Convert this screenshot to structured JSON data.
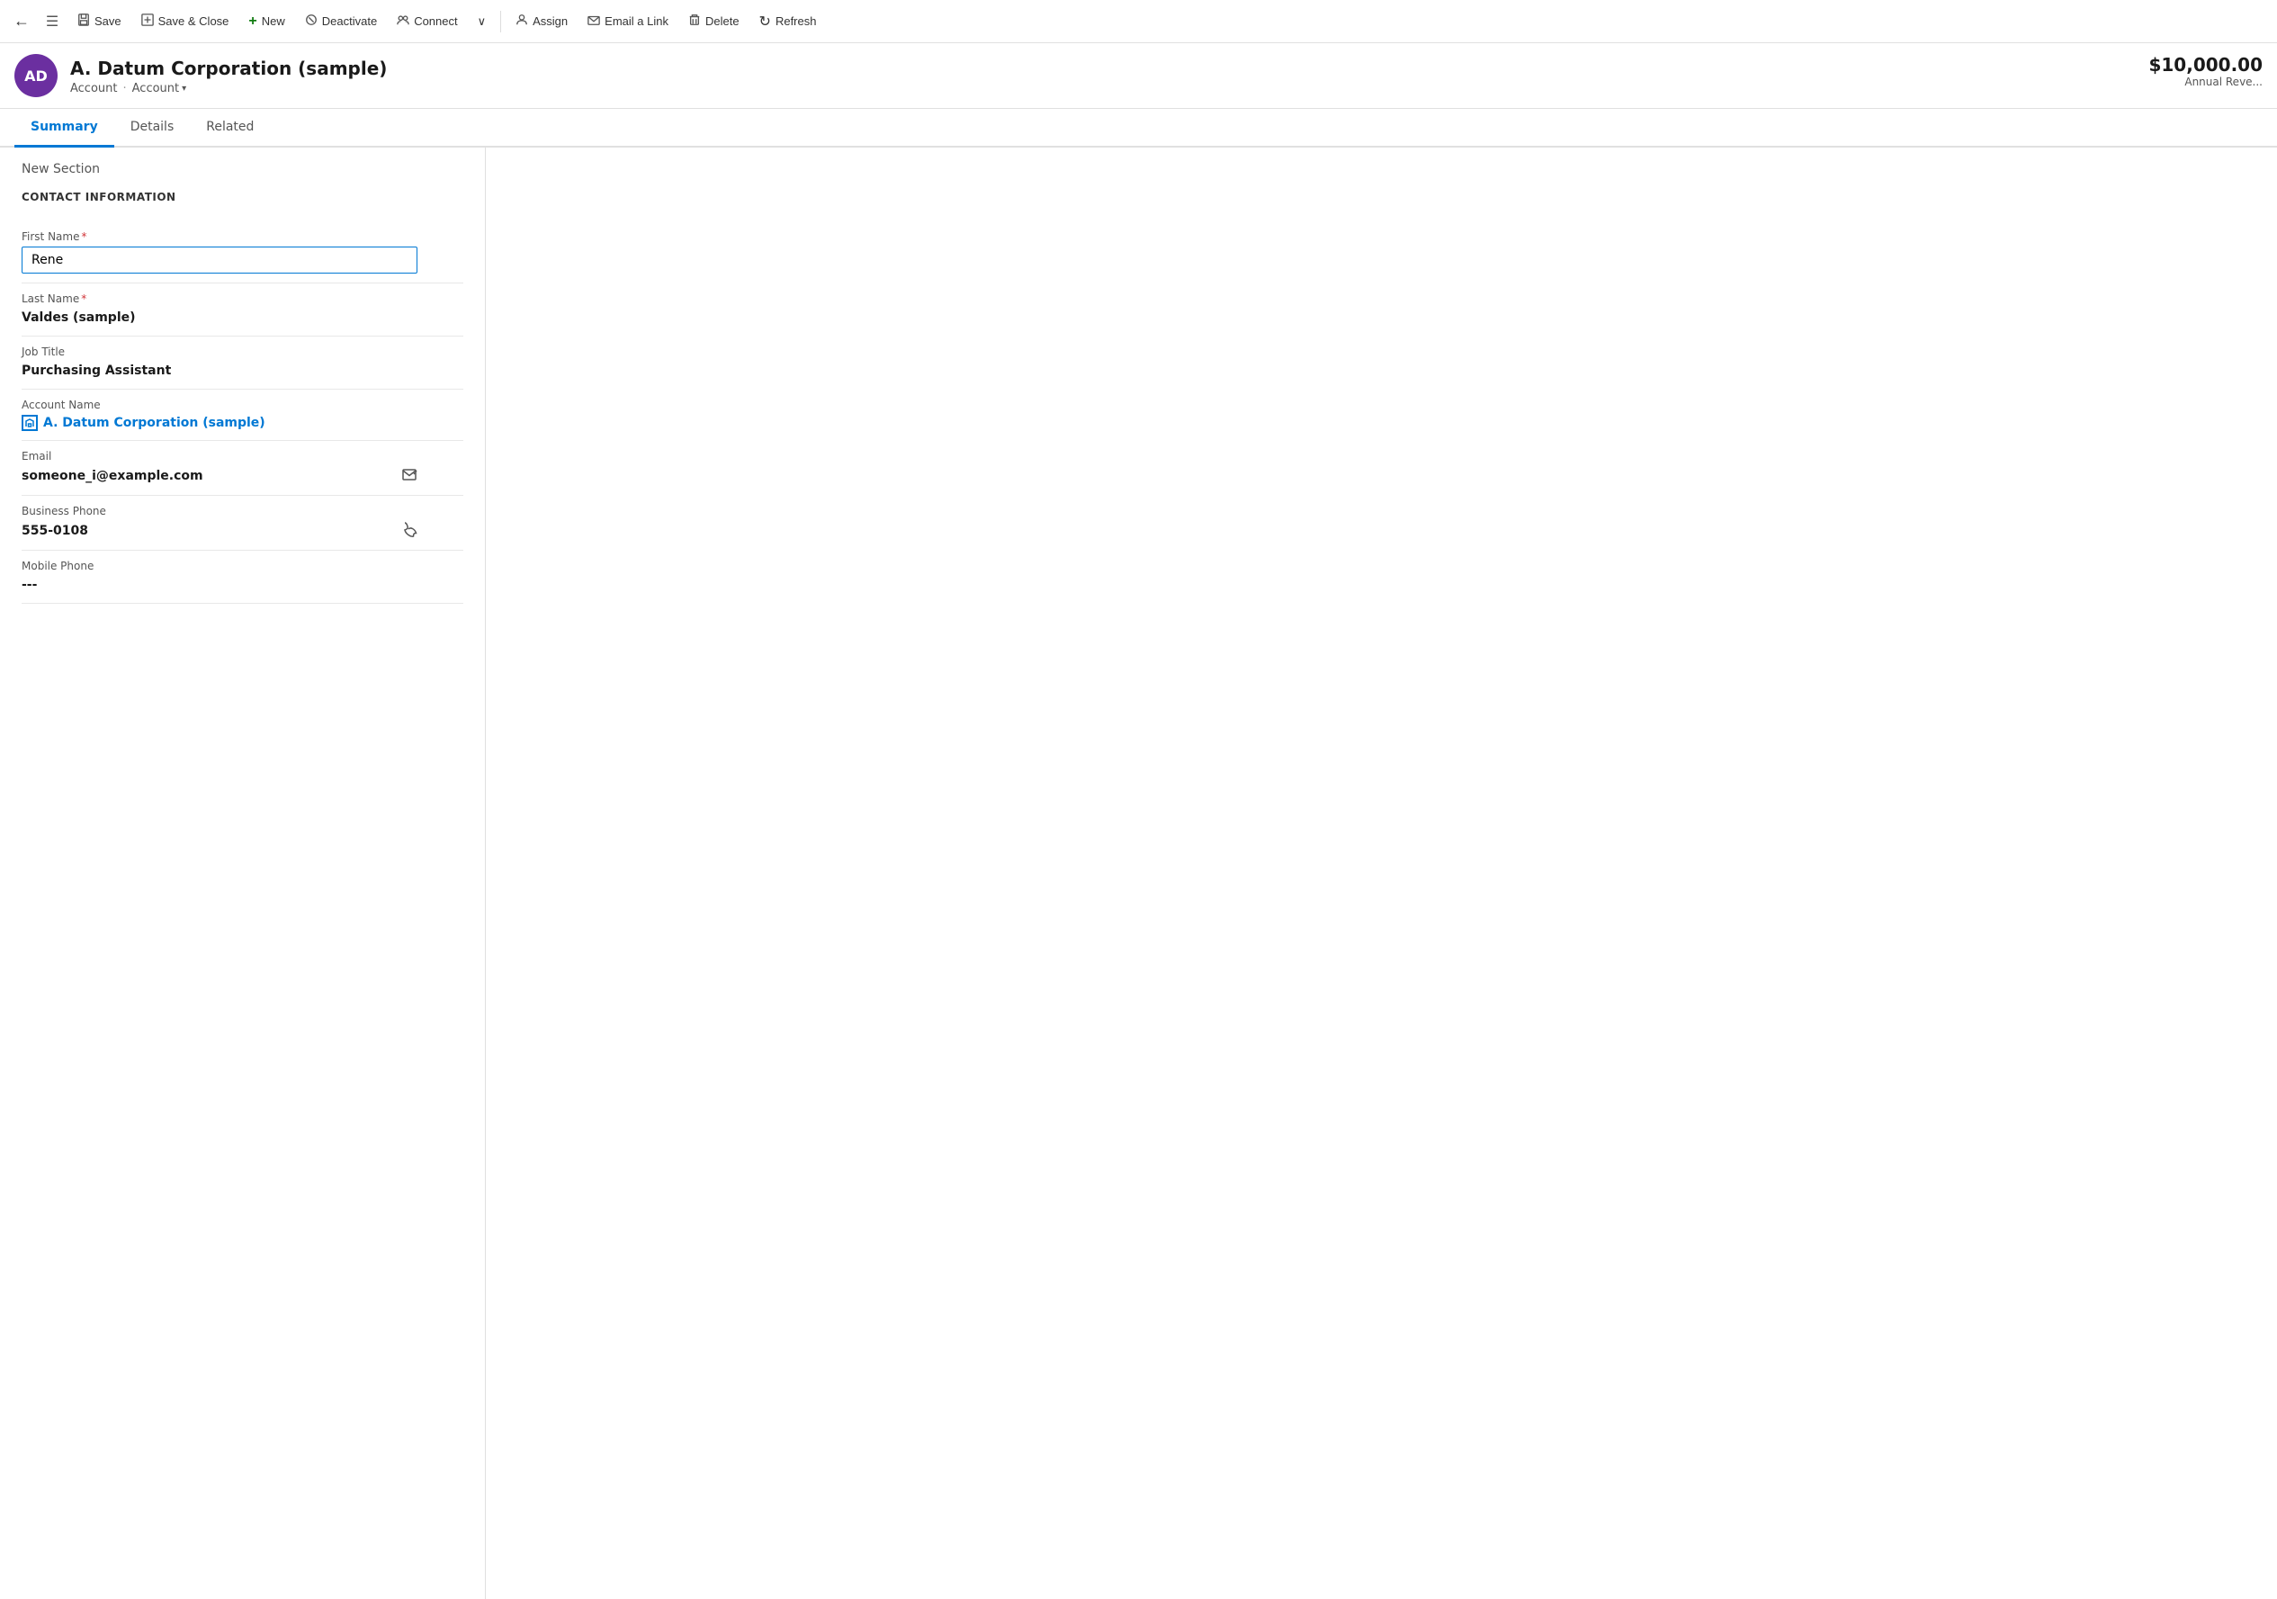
{
  "toolbar": {
    "back_label": "←",
    "list_label": "☰",
    "save_label": "Save",
    "save_close_label": "Save & Close",
    "new_label": "New",
    "deactivate_label": "Deactivate",
    "connect_label": "Connect",
    "more_label": "∨",
    "assign_label": "Assign",
    "email_link_label": "Email a Link",
    "delete_label": "Delete",
    "refresh_label": "Refresh"
  },
  "header": {
    "avatar_initials": "AD",
    "avatar_bg": "#6b2fa0",
    "record_name": "A. Datum Corporation (sample)",
    "breadcrumb1": "Account",
    "breadcrumb2": "Account",
    "annual_revenue": "$10,000.00",
    "annual_revenue_label": "Annual Reve..."
  },
  "tabs": {
    "items": [
      {
        "id": "summary",
        "label": "Summary",
        "active": true
      },
      {
        "id": "details",
        "label": "Details",
        "active": false
      },
      {
        "id": "related",
        "label": "Related",
        "active": false
      }
    ]
  },
  "form": {
    "section_title": "New Section",
    "section_heading": "CONTACT INFORMATION",
    "fields": [
      {
        "id": "first_name",
        "label": "First Name",
        "required": true,
        "type": "input",
        "value": "Rene"
      },
      {
        "id": "last_name",
        "label": "Last Name",
        "required": true,
        "type": "text",
        "value": "Valdes (sample)"
      },
      {
        "id": "job_title",
        "label": "Job Title",
        "required": false,
        "type": "text",
        "value": "Purchasing Assistant"
      },
      {
        "id": "account_name",
        "label": "Account Name",
        "required": false,
        "type": "link",
        "value": "A. Datum Corporation (sample)"
      },
      {
        "id": "email",
        "label": "Email",
        "required": false,
        "type": "email",
        "value": "someone_i@example.com"
      },
      {
        "id": "business_phone",
        "label": "Business Phone",
        "required": false,
        "type": "phone",
        "value": "555-0108"
      },
      {
        "id": "mobile_phone",
        "label": "Mobile Phone",
        "required": false,
        "type": "text",
        "value": "---"
      }
    ]
  }
}
